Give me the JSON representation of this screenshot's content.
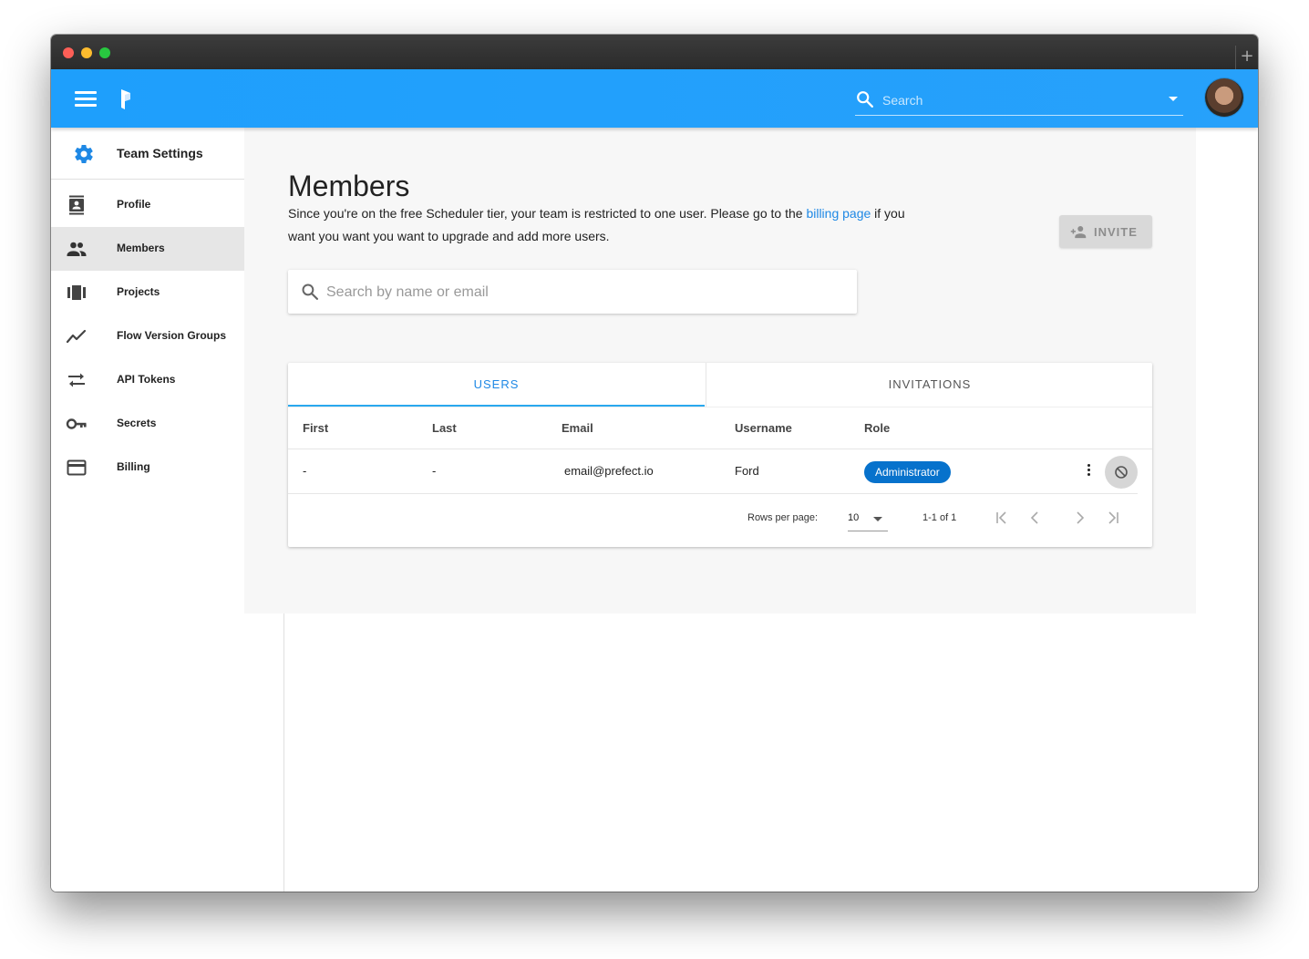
{
  "header": {
    "search_placeholder": "Search"
  },
  "sidebar": {
    "title": "Team Settings",
    "items": [
      {
        "label": "Profile"
      },
      {
        "label": "Members"
      },
      {
        "label": "Projects"
      },
      {
        "label": "Flow Version Groups"
      },
      {
        "label": "API Tokens"
      },
      {
        "label": "Secrets"
      },
      {
        "label": "Billing"
      }
    ],
    "active": "Members"
  },
  "main": {
    "title": "Members",
    "description_before": "Since you're on the free Scheduler tier, your team is restricted to one user. Please go to the ",
    "billing_link": "billing page",
    "description_after": " if you want you want you want to upgrade and add more users.",
    "invite_label": "INVITE",
    "search_placeholder": "Search by name or email"
  },
  "tabs": {
    "users": "USERS",
    "invitations": "INVITATIONS",
    "active": "USERS"
  },
  "table": {
    "headers": {
      "first": "First",
      "last": "Last",
      "email": "Email",
      "username": "Username",
      "role": "Role"
    },
    "rows": [
      {
        "first": "-",
        "last": "-",
        "email": "email@prefect.io",
        "username": "Ford",
        "role": "Administrator"
      }
    ]
  },
  "pagination": {
    "rows_per_page_label": "Rows per page:",
    "rows_per_page": "10",
    "range": "1-1 of 1"
  },
  "colors": {
    "appbar": "#1e9ffc",
    "accent": "#1e88e5",
    "role_badge": "#0772cc",
    "gear": "#1e88e5"
  }
}
